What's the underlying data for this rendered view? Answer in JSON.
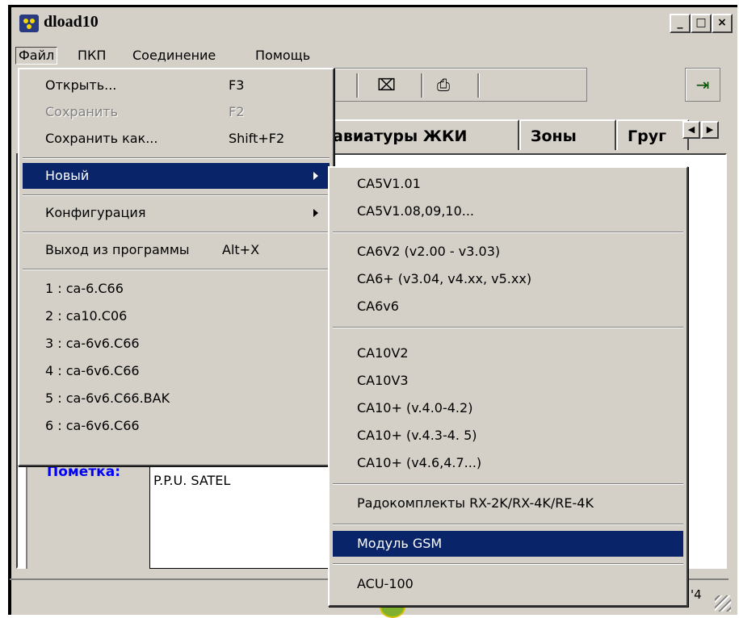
{
  "window": {
    "title": "dload10",
    "minimize": "_",
    "maximize": "□",
    "close": "×"
  },
  "menubar": [
    "Файл",
    "ПКП",
    "Соединение",
    "Помощь"
  ],
  "tabs": [
    "авиатуры ЖКИ",
    "Зоны",
    "Груг"
  ],
  "tab_arrows": [
    "◀",
    "▶"
  ],
  "note": {
    "label": "Пометка:",
    "value": "P.P.U. SATEL"
  },
  "status": {
    "text": "'4"
  },
  "file_menu": [
    {
      "label": "Открыть...",
      "shortcut": "F3",
      "state": "normal"
    },
    {
      "label": "Сохранить",
      "shortcut": "F2",
      "state": "disabled"
    },
    {
      "label": "Сохранить как...",
      "shortcut": "Shift+F2",
      "state": "normal"
    },
    {
      "label": "Новый",
      "shortcut": "",
      "state": "highlighted",
      "submenu": true
    },
    {
      "label": "Конфигурация",
      "shortcut": "",
      "state": "normal",
      "submenu": true
    },
    {
      "label": "Выход из программы",
      "shortcut": "Alt+X",
      "state": "normal"
    },
    {
      "label": "1 : ca-6.C66"
    },
    {
      "label": "2 : ca10.C06"
    },
    {
      "label": "3 : ca-6v6.C66"
    },
    {
      "label": "4 : ca-6v6.C66"
    },
    {
      "label": "5 : ca-6v6.C66.BAK"
    },
    {
      "label": "6 : ca-6v6.C66"
    }
  ],
  "new_submenu": [
    "CA5V1.01",
    "CA5V1.08,09,10...",
    "CA6V2 (v2.00 - v3.03)",
    "CA6+ (v3.04, v4.xx, v5.xx)",
    "CA6v6",
    "CA10V2",
    "CA10V3",
    "CA10+ (v.4.0-4.2)",
    "CA10+ (v.4.3-4. 5)",
    "CA10+ (v4.6,4.7...)",
    "Радокомплекты RX-2K/RX-4K/RE-4K",
    "Модуль GSM",
    "ACU-100"
  ],
  "colors": {
    "face": "#d4d0c8",
    "highlight": "#0a246a",
    "note_label": "#0000ff"
  }
}
